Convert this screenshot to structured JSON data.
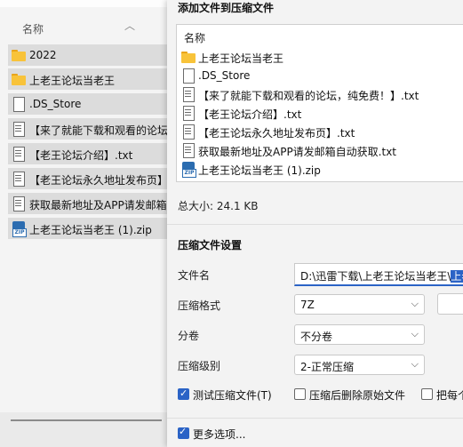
{
  "explorer": {
    "column_name": "名称",
    "items": [
      {
        "label": "2022",
        "icon": "folder-icon"
      },
      {
        "label": "上老王论坛当老王",
        "icon": "folder-icon"
      },
      {
        "label": ".DS_Store",
        "icon": "file-icon"
      },
      {
        "label": "【来了就能下载和观看的论坛，纯免费！】.txt",
        "icon": "text-file-icon"
      },
      {
        "label": "【老王论坛介绍】.txt",
        "icon": "text-file-icon"
      },
      {
        "label": "【老王论坛永久地址发布页】.txt",
        "icon": "text-file-icon"
      },
      {
        "label": "获取最新地址及APP请发邮箱自动获取.txt",
        "icon": "text-file-icon"
      },
      {
        "label": "上老王论坛当老王 (1).zip",
        "icon": "zip-icon"
      }
    ]
  },
  "dialog": {
    "title": "添加文件到压缩文件",
    "list_header": "名称",
    "files": [
      {
        "label": "上老王论坛当老王",
        "icon": "folder-icon"
      },
      {
        "label": ".DS_Store",
        "icon": "file-icon"
      },
      {
        "label": "【来了就能下载和观看的论坛，纯免费！】.txt",
        "icon": "text-file-icon"
      },
      {
        "label": "【老王论坛介绍】.txt",
        "icon": "text-file-icon"
      },
      {
        "label": "【老王论坛永久地址发布页】.txt",
        "icon": "text-file-icon"
      },
      {
        "label": "获取最新地址及APP请发邮箱自动获取.txt",
        "icon": "text-file-icon"
      },
      {
        "label": "上老王论坛当老王 (1).zip",
        "icon": "zip-icon"
      }
    ],
    "total_size": "总大小: 24.1 KB",
    "settings_title": "压缩文件设置",
    "filename_label": "文件名",
    "filename_path": "D:\\迅雷下载\\上老王论坛当老王\\",
    "filename_selected": "上老",
    "format_label": "压缩格式",
    "format_value": "7Z",
    "split_label": "分卷",
    "split_value": "不分卷",
    "level_label": "压缩级别",
    "level_value": "2-正常压缩",
    "options": [
      {
        "label": "测试压缩文件(T)",
        "checked": true
      },
      {
        "label": "压缩后删除原始文件",
        "checked": false
      },
      {
        "label": "把每个",
        "checked": false
      }
    ],
    "more_options": "更多选项...",
    "accent_color": "#2b63c6"
  }
}
